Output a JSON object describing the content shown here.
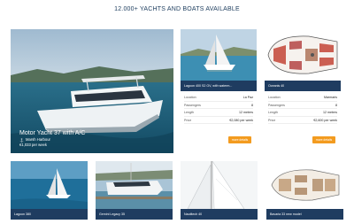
{
  "heading": "12.000+ YACHTS AND BOATS AVAILABLE",
  "featured": {
    "title": "Motor Yacht 37 with A/C",
    "location": "Marsh Harbour",
    "price": "€1,033 per week"
  },
  "details": [
    {
      "name": "Lagoon 400 S2 GV, with waterm...",
      "rows": [
        {
          "label": "Location",
          "value": "La Paz"
        },
        {
          "label": "Passengers",
          "value": "8"
        },
        {
          "label": "Length",
          "value": "12 meters"
        },
        {
          "label": "Price",
          "value": "€2,080 per week"
        }
      ],
      "button": "more details"
    },
    {
      "name": "Oceanis 40",
      "rows": [
        {
          "label": "Location",
          "value": "Marmaris"
        },
        {
          "label": "Passengers",
          "value": "8"
        },
        {
          "label": "Length",
          "value": "12 meters"
        },
        {
          "label": "Price",
          "value": "€2,600 per week"
        }
      ],
      "button": "more details"
    }
  ],
  "small_cards": [
    {
      "name": "Lagoon 380"
    },
    {
      "name": "Gemini Legacy 35"
    },
    {
      "name": "Nautitech 40"
    },
    {
      "name": "Bavaria 33 new model"
    }
  ]
}
